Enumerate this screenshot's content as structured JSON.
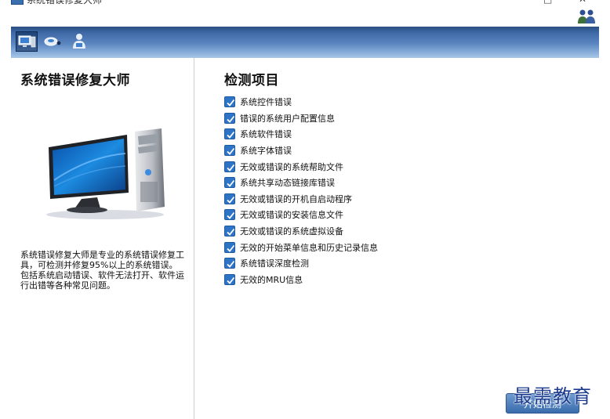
{
  "window": {
    "title": "系统错误修复大师",
    "min_glyph": "□",
    "close_glyph": "✕"
  },
  "toolbar": {
    "buttons": [
      {
        "icon": "computer-icon",
        "active": true
      },
      {
        "icon": "mouse-icon",
        "active": false
      },
      {
        "icon": "person-icon",
        "active": false
      }
    ],
    "users_icon": "users-icon"
  },
  "left_panel": {
    "title": "系统错误修复大师",
    "description_1": "系统错误修复大师是专业的系统错误修复工具，可检测并修复95%以上的系统错误。",
    "description_2": "包括系统启动错误、软件无法打开、软件运行出错等各种常见问题。"
  },
  "right_panel": {
    "title": "检测项目",
    "items": [
      {
        "label": "系统控件错误",
        "checked": true
      },
      {
        "label": "错误的系统用户配置信息",
        "checked": true
      },
      {
        "label": "系统软件错误",
        "checked": true
      },
      {
        "label": "系统字体错误",
        "checked": true
      },
      {
        "label": "无效或错误的系统帮助文件",
        "checked": true
      },
      {
        "label": "系统共享动态链接库错误",
        "checked": true
      },
      {
        "label": "无效或错误的开机自启动程序",
        "checked": true
      },
      {
        "label": "无效或错误的安装信息文件",
        "checked": true
      },
      {
        "label": "无效或错误的系统虚拟设备",
        "checked": true
      },
      {
        "label": "无效的开始菜单信息和历史记录信息",
        "checked": true
      },
      {
        "label": "系统错误深度检测",
        "checked": true
      },
      {
        "label": "无效的MRU信息",
        "checked": true
      }
    ]
  },
  "start_button": {
    "label": "开始检测"
  },
  "watermark": {
    "text": "最需教育"
  },
  "colors": {
    "accent": "#2e74c6",
    "toolbar": "#4f7cb8",
    "watermark": "#1c3b8f"
  }
}
